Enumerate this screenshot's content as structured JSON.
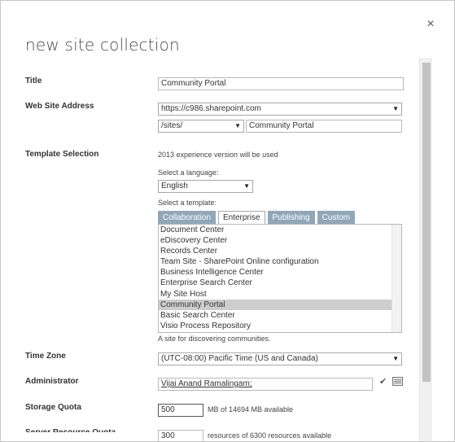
{
  "dialog": {
    "title": "new site collection",
    "close_glyph": "×"
  },
  "fields": {
    "title": {
      "label": "Title",
      "value": "Community Portal"
    },
    "web_site_address": {
      "label": "Web Site Address",
      "domain": "https://c986.sharepoint.com",
      "path_prefix": "/sites/",
      "path": "Community Portal"
    },
    "template_selection": {
      "label": "Template Selection",
      "experience_note": "2013 experience version will be used",
      "language_label": "Select a language:",
      "language": "English",
      "template_label": "Select a template:",
      "tabs": [
        "Collaboration",
        "Enterprise",
        "Publishing",
        "Custom"
      ],
      "active_tab": "Enterprise",
      "templates": [
        "Document Center",
        "eDiscovery Center",
        "Records Center",
        "Team Site - SharePoint Online configuration",
        "Business Intelligence Center",
        "Enterprise Search Center",
        "My Site Host",
        "Community Portal",
        "Basic Search Center",
        "Visio Process Repository"
      ],
      "selected_template": "Community Portal",
      "description": "A site for discovering communities."
    },
    "time_zone": {
      "label": "Time Zone",
      "value": "(UTC-08:00) Pacific Time (US and Canada)"
    },
    "administrator": {
      "label": "Administrator",
      "value": "Vijai Anand Ramalingam;"
    },
    "storage_quota": {
      "label": "Storage Quota",
      "value": "500",
      "suffix": "MB of 14694 MB available"
    },
    "server_resource_quota": {
      "label": "Server Resource Quota",
      "value": "300",
      "suffix": "resources of 6300 resources available"
    }
  },
  "icons": {
    "close": "close-icon",
    "dropdown": "chevron-down-icon",
    "people_picker": "people-picker-icon",
    "address_book": "address-book-icon"
  }
}
